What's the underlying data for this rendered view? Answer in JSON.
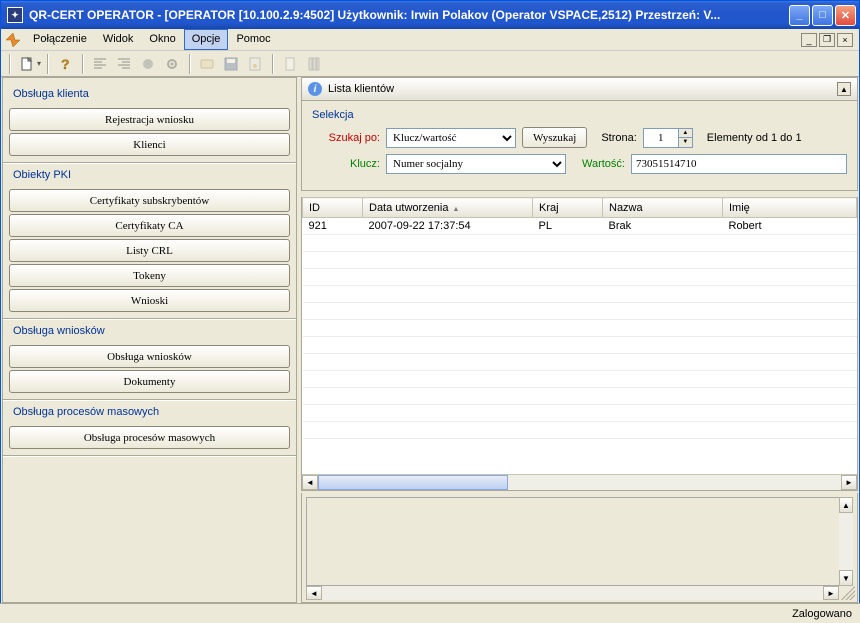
{
  "window": {
    "title": "QR-CERT OPERATOR - [OPERATOR [10.100.2.9:4502] Użytkownik: Irwin Polakov (Operator VSPACE,2512) Przestrzeń: V..."
  },
  "menu": {
    "items": [
      "Połączenie",
      "Widok",
      "Okno",
      "Opcje",
      "Pomoc"
    ],
    "active_index": 3
  },
  "sidebar": {
    "groups": [
      {
        "title": "Obsługa klienta",
        "buttons": [
          "Rejestracja wniosku",
          "Klienci"
        ]
      },
      {
        "title": "Obiekty PKI",
        "buttons": [
          "Certyfikaty subskrybentów",
          "Certyfikaty CA",
          "Listy CRL",
          "Tokeny",
          "Wnioski"
        ]
      },
      {
        "title": "Obsługa wniosków",
        "buttons": [
          "Obsługa wniosków",
          "Dokumenty"
        ]
      },
      {
        "title": "Obsługa procesów masowych",
        "buttons": [
          "Obsługa procesów masowych"
        ]
      }
    ]
  },
  "panel": {
    "title": "Lista klientów"
  },
  "selekcja": {
    "title": "Selekcja",
    "szukaj_po_label": "Szukaj po:",
    "szukaj_po_value": "Klucz/wartość",
    "wyszukaj_label": "Wyszukaj",
    "strona_label": "Strona:",
    "strona_value": "1",
    "elementy_label": "Elementy od 1 do 1",
    "klucz_label": "Klucz:",
    "klucz_value": "Numer socjalny",
    "wartosc_label": "Wartość:",
    "wartosc_value": "73051514710"
  },
  "table": {
    "columns": [
      "ID",
      "Data utworzenia",
      "Kraj",
      "Nazwa",
      "Imię"
    ],
    "sort_col_index": 1,
    "rows": [
      {
        "id": "921",
        "data_utworzenia": "2007-09-22 17:37:54",
        "kraj": "PL",
        "nazwa": "Brak",
        "imie": "Robert"
      }
    ]
  },
  "status": {
    "text": "Zalogowano"
  }
}
